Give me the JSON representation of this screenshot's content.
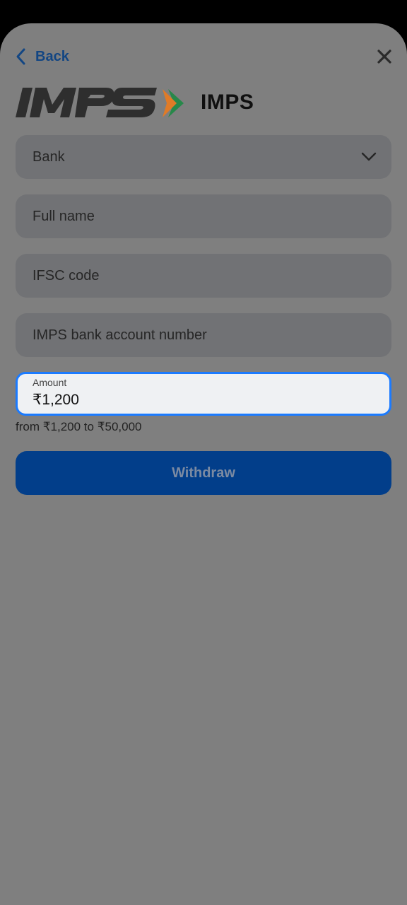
{
  "header": {
    "back_label": "Back",
    "back_icon": "chevron-left-icon",
    "close_icon": "close-icon"
  },
  "brand": {
    "logo_text": "IMPS",
    "title": "IMPS"
  },
  "form": {
    "bank": {
      "placeholder": "Bank",
      "icon": "chevron-down-icon"
    },
    "full_name": {
      "placeholder": "Full name"
    },
    "ifsc": {
      "placeholder": "IFSC code"
    },
    "account": {
      "placeholder": "IMPS bank account number"
    },
    "amount": {
      "label": "Amount",
      "value": "₹1,200",
      "hint": "from ₹1,200 to ₹50,000"
    },
    "submit_label": "Withdraw"
  },
  "colors": {
    "overlay_background": "#7f7f7f",
    "field_background": "#717275",
    "focus_border": "#1b7bff",
    "button_background": "#023e8a",
    "back_link": "#134683"
  }
}
